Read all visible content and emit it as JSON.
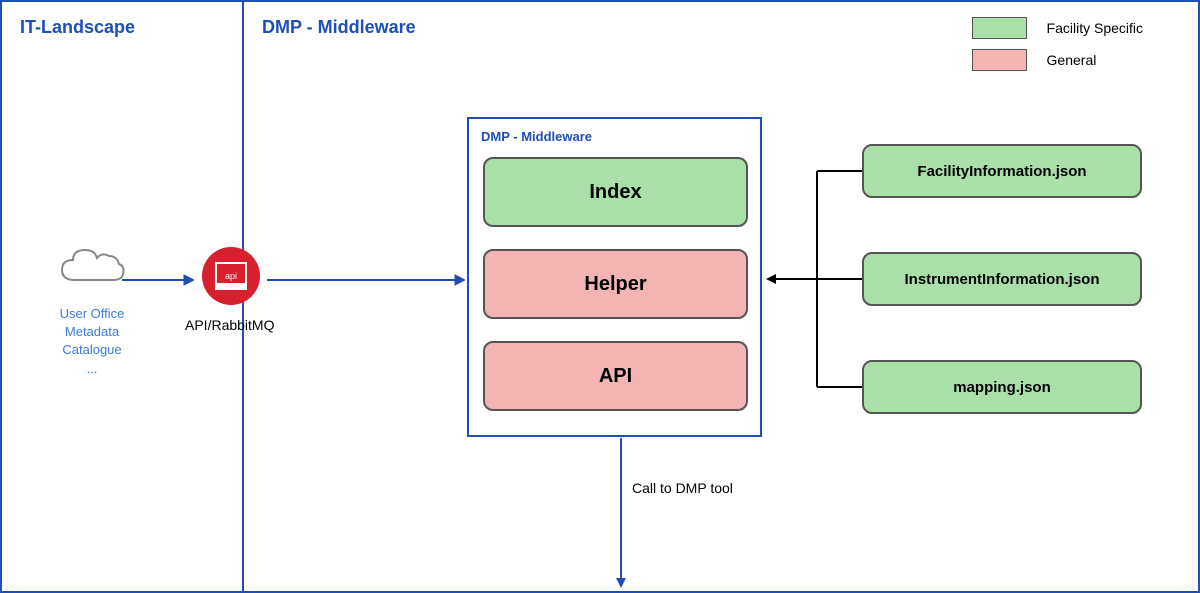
{
  "sections": {
    "left_title": "IT-Landscape",
    "right_title": "DMP - Middleware"
  },
  "cloud": {
    "line1": "User Office",
    "line2": "Metadata Catalogue",
    "line3": "..."
  },
  "api_node": {
    "inner_text": "api",
    "label": "API/RabbitMQ"
  },
  "middleware": {
    "title": "DMP - Middleware",
    "boxes": {
      "index": "Index",
      "helper": "Helper",
      "api": "API"
    }
  },
  "json_files": {
    "facility": "FacilityInformation.json",
    "instrument": "InstrumentInformation.json",
    "mapping": "mapping.json"
  },
  "legend": {
    "facility_specific": "Facility Specific",
    "general": "General"
  },
  "call_label": "Call to DMP tool",
  "colors": {
    "green": "#a8e0a8",
    "pink": "#f4b4b4",
    "blue": "#1e4fb8",
    "red": "#d71f2e"
  }
}
